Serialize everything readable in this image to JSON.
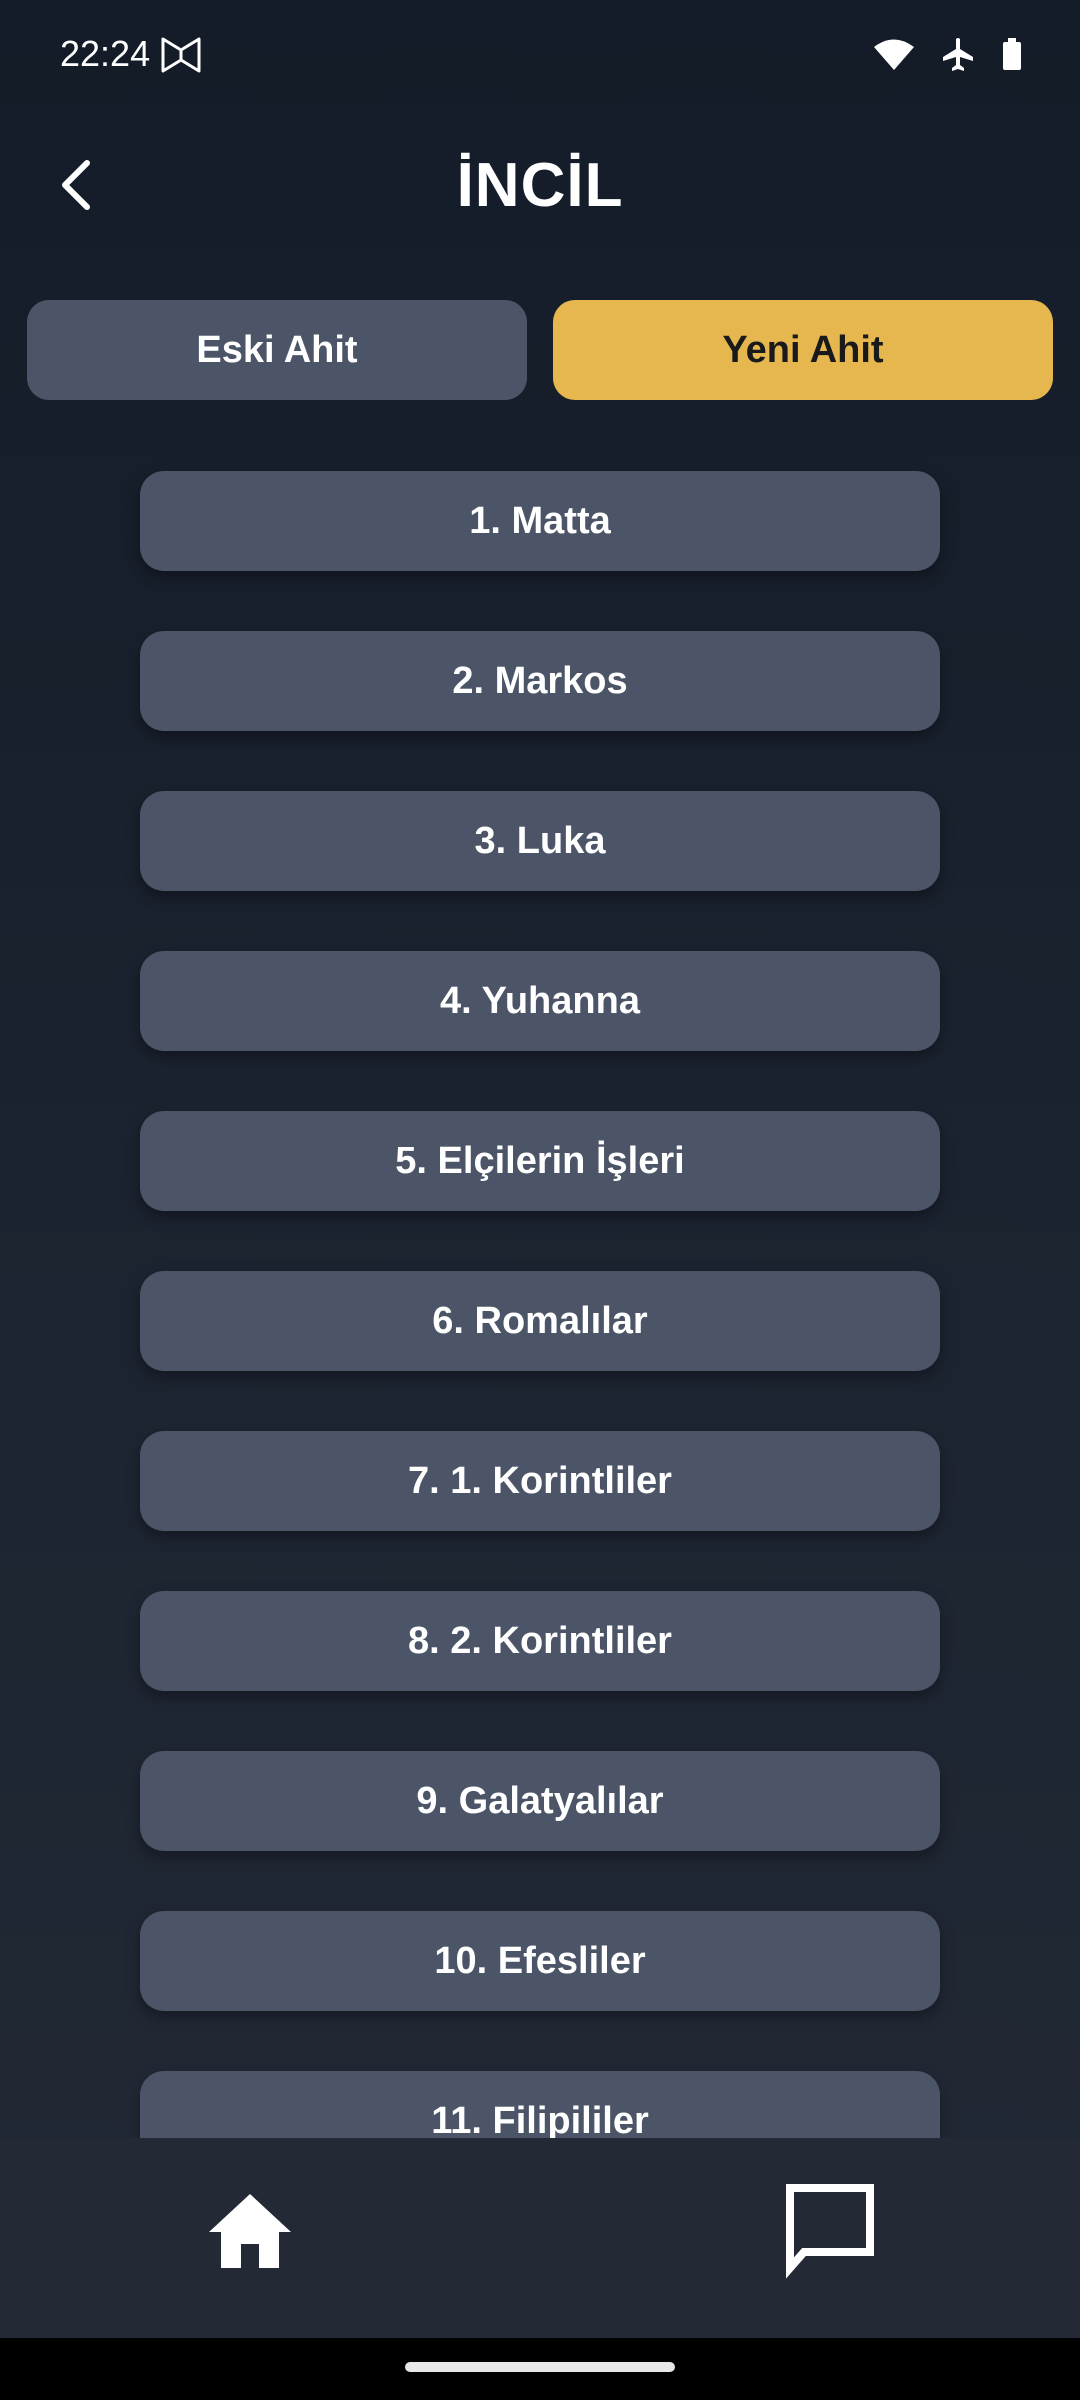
{
  "status_bar": {
    "time": "22:24",
    "icons": [
      "app-notification-icon",
      "wifi-icon",
      "airplane-mode-icon",
      "battery-icon"
    ]
  },
  "header": {
    "title": "İNCİL",
    "back_icon": "chevron-left-icon"
  },
  "tabs": [
    {
      "label": "Eski Ahit",
      "selected": false
    },
    {
      "label": "Yeni Ahit",
      "selected": true
    }
  ],
  "books": [
    "1. Matta",
    "2. Markos",
    "3. Luka",
    "4. Yuhanna",
    "5. Elçilerin İşleri",
    "6. Romalılar",
    "7. 1. Korintliler",
    "8. 2. Korintliler",
    "9. Galatyalılar",
    "10. Efesliler",
    "11. Filipililer"
  ],
  "bottom_nav": {
    "items": [
      "home-icon",
      "chat-icon"
    ]
  },
  "colors": {
    "background_top": "#131c28",
    "background_bottom": "#232a36",
    "button": "#4b5567",
    "accent": "#e6b74e"
  }
}
